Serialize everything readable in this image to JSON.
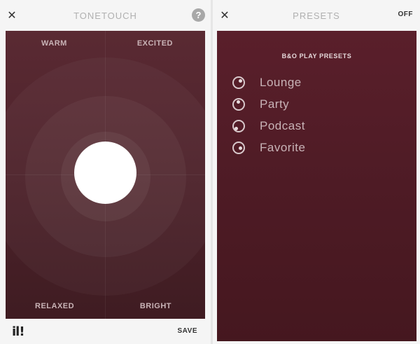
{
  "tonetouch": {
    "title": "TONETOUCH",
    "close_label": "✕",
    "help_label": "?",
    "corners": {
      "warm": "WARM",
      "excited": "EXCITED",
      "relaxed": "RELAXED",
      "bright": "BRIGHT"
    },
    "brand": "il!",
    "save_label": "SAVE"
  },
  "presets": {
    "title": "PRESETS",
    "close_label": "✕",
    "off_label": "OFF",
    "heading": "B&O PLAY PRESETS",
    "items": [
      {
        "label": "Lounge"
      },
      {
        "label": "Party"
      },
      {
        "label": "Podcast"
      },
      {
        "label": "Favorite"
      }
    ]
  },
  "colors": {
    "pad_background": "#4c222a",
    "presets_background": "#4e1b25",
    "knob": "#ffffff",
    "text_muted": "#b0b0b0"
  }
}
